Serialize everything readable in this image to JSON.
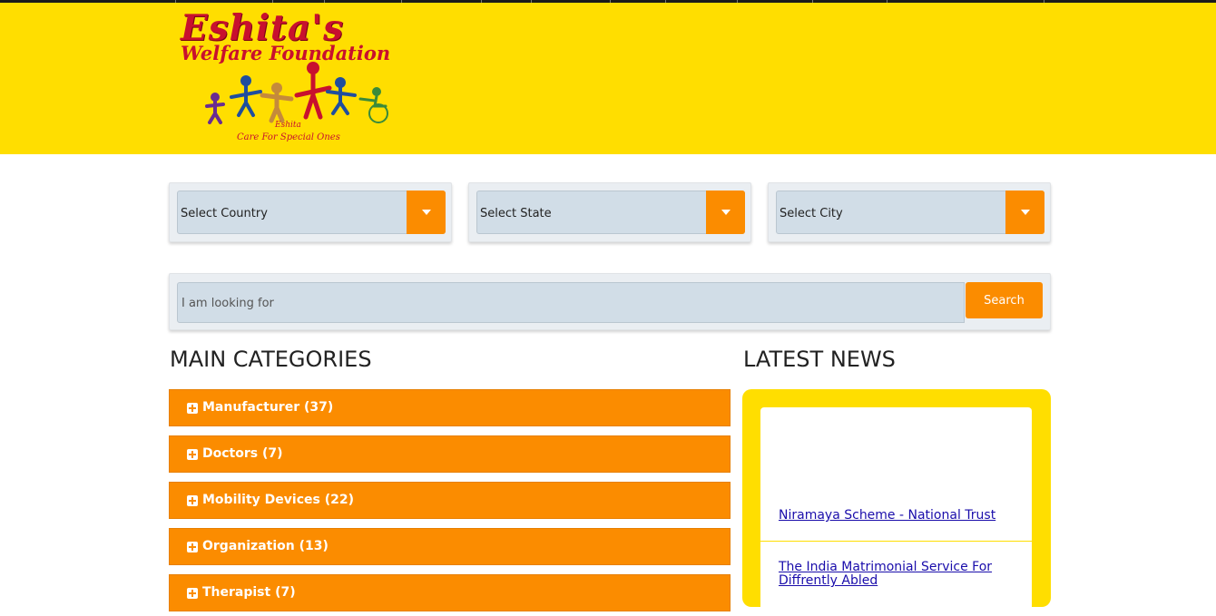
{
  "header": {
    "logo": {
      "line1": "Eshita's",
      "line2": "Welfare Foundation",
      "line3": "Eshita",
      "line4": "Care For Special Ones"
    }
  },
  "filters": {
    "country": "Select Country",
    "state": "Select State",
    "city": "Select City"
  },
  "search": {
    "placeholder": "I am looking for",
    "button_label": "Search"
  },
  "main_categories": {
    "heading": "MAIN CATEGORIES",
    "items": [
      {
        "label": "Manufacturer (37)"
      },
      {
        "label": "Doctors (7)"
      },
      {
        "label": "Mobility Devices (22)"
      },
      {
        "label": "Organization (13)"
      },
      {
        "label": "Therapist (7)"
      }
    ]
  },
  "latest_news": {
    "heading": "LATEST NEWS",
    "items": [
      {
        "title": "Niramaya Scheme - National Trust"
      },
      {
        "title": "The India Matrimonial Service For Diffrently Abled"
      }
    ]
  },
  "colors": {
    "header_bg": "#ffde00",
    "accent_orange": "#fb8c00",
    "field_bg": "#d1dde7",
    "logo_red": "#c8102e",
    "link": "#1a0dab"
  }
}
